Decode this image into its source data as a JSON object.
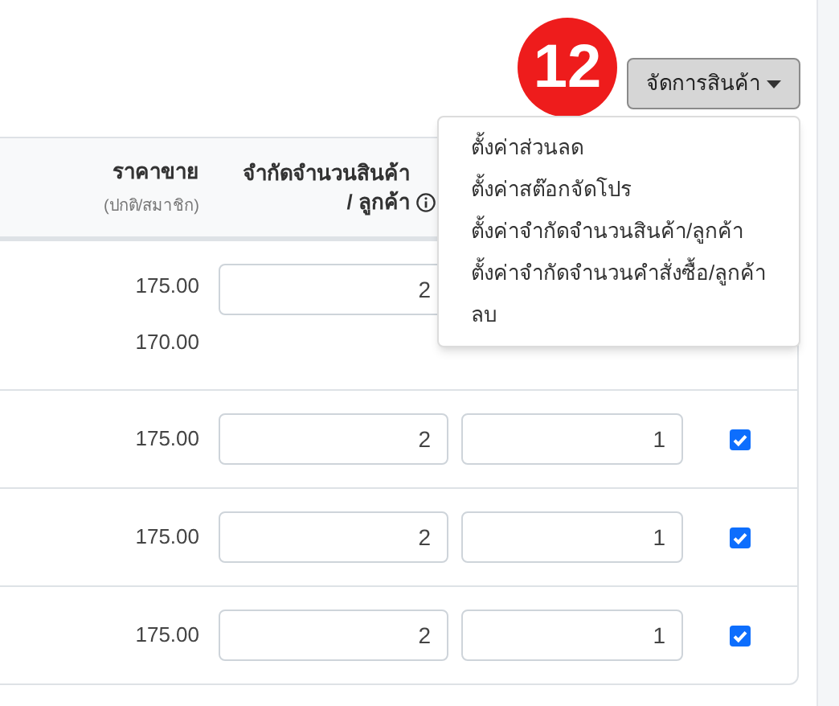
{
  "badge": "12",
  "manage_button": {
    "label": "จัดการสินค้า",
    "expanded": true
  },
  "menu": [
    "ตั้งค่าส่วนลด",
    "ตั้งค่าสต๊อกจัดโปร",
    "ตั้งค่าจำกัดจำนวนสินค้า/ลูกค้า",
    "ตั้งค่าจำกัดจำนวนคำสั่งซื้อ/ลูกค้า",
    "ลบ"
  ],
  "table": {
    "columns": [
      {
        "title": "ราคาขาย",
        "subtitle": "(ปกติ/สมาชิก)"
      },
      {
        "title": "จำกัดจำนวนสินค้า / ลูกค้า",
        "info": true
      }
    ],
    "rows": [
      {
        "prices": [
          "175.00",
          "170.00"
        ],
        "limit_qty": "2"
      },
      {
        "prices": [
          "175.00"
        ],
        "limit_qty": "2",
        "limit_orders": "1",
        "checked": true
      },
      {
        "prices": [
          "175.00"
        ],
        "limit_qty": "2",
        "limit_orders": "1",
        "checked": true
      },
      {
        "prices": [
          "175.00"
        ],
        "limit_qty": "2",
        "limit_orders": "1",
        "checked": true
      }
    ]
  }
}
